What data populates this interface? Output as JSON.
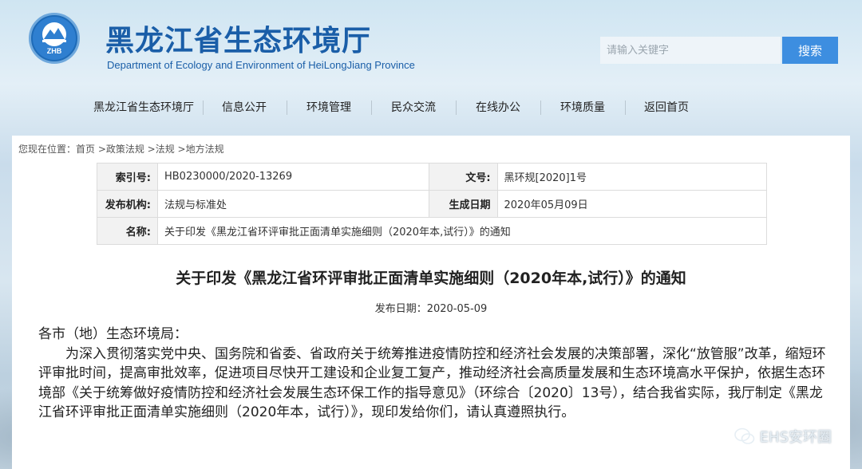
{
  "header": {
    "title": "黑龙江省生态环境厅",
    "subtitle": "Department of Ecology and Environment  of HeiLongJiang Province",
    "logo_text": "ZHB",
    "search_placeholder": "请输入关键字",
    "search_button": "搜索"
  },
  "nav": {
    "items": [
      "黑龙江省生态环境厅",
      "信息公开",
      "环境管理",
      "民众交流",
      "在线办公",
      "环境质量",
      "返回首页"
    ]
  },
  "breadcrumb": "您现在位置：首页 >政策法规 >法规 >地方法规",
  "meta": {
    "index_label": "索引号:",
    "index_value": "HB0230000/2020-13269",
    "docno_label": "文号:",
    "docno_value": "黑环规[2020]1号",
    "org_label": "发布机构:",
    "org_value": "法规与标准处",
    "date_label": "生成日期",
    "date_value": "2020年05月09日",
    "name_label": "名称:",
    "name_value": "关于印发《黑龙江省环评审批正面清单实施细则（2020年本,试行）》的通知"
  },
  "doc": {
    "title": "关于印发《黑龙江省环评审批正面清单实施细则（2020年本,试行）》的通知",
    "pub_date": "发布日期：2020-05-09",
    "salutation": "各市（地）生态环境局：",
    "paragraph": "为深入贯彻落实党中央、国务院和省委、省政府关于统筹推进疫情防控和经济社会发展的决策部署，深化“放管服”改革，缩短环评审批时间，提高审批效率，促进项目尽快开工建设和企业复工复产，推动经济社会高质量发展和生态环境高水平保护，依据生态环境部《关于统筹做好疫情防控和经济社会发展生态环保工作的指导意见》（环综合〔2020〕13号），结合我省实际，我厅制定《黑龙江省环评审批正面清单实施细则（2020年本，试行）》，现印发给你们，请认真遵照执行。"
  },
  "watermark": "EHS安环圈",
  "colors": {
    "brand": "#1a5ea8",
    "button": "#3d8ee0"
  }
}
